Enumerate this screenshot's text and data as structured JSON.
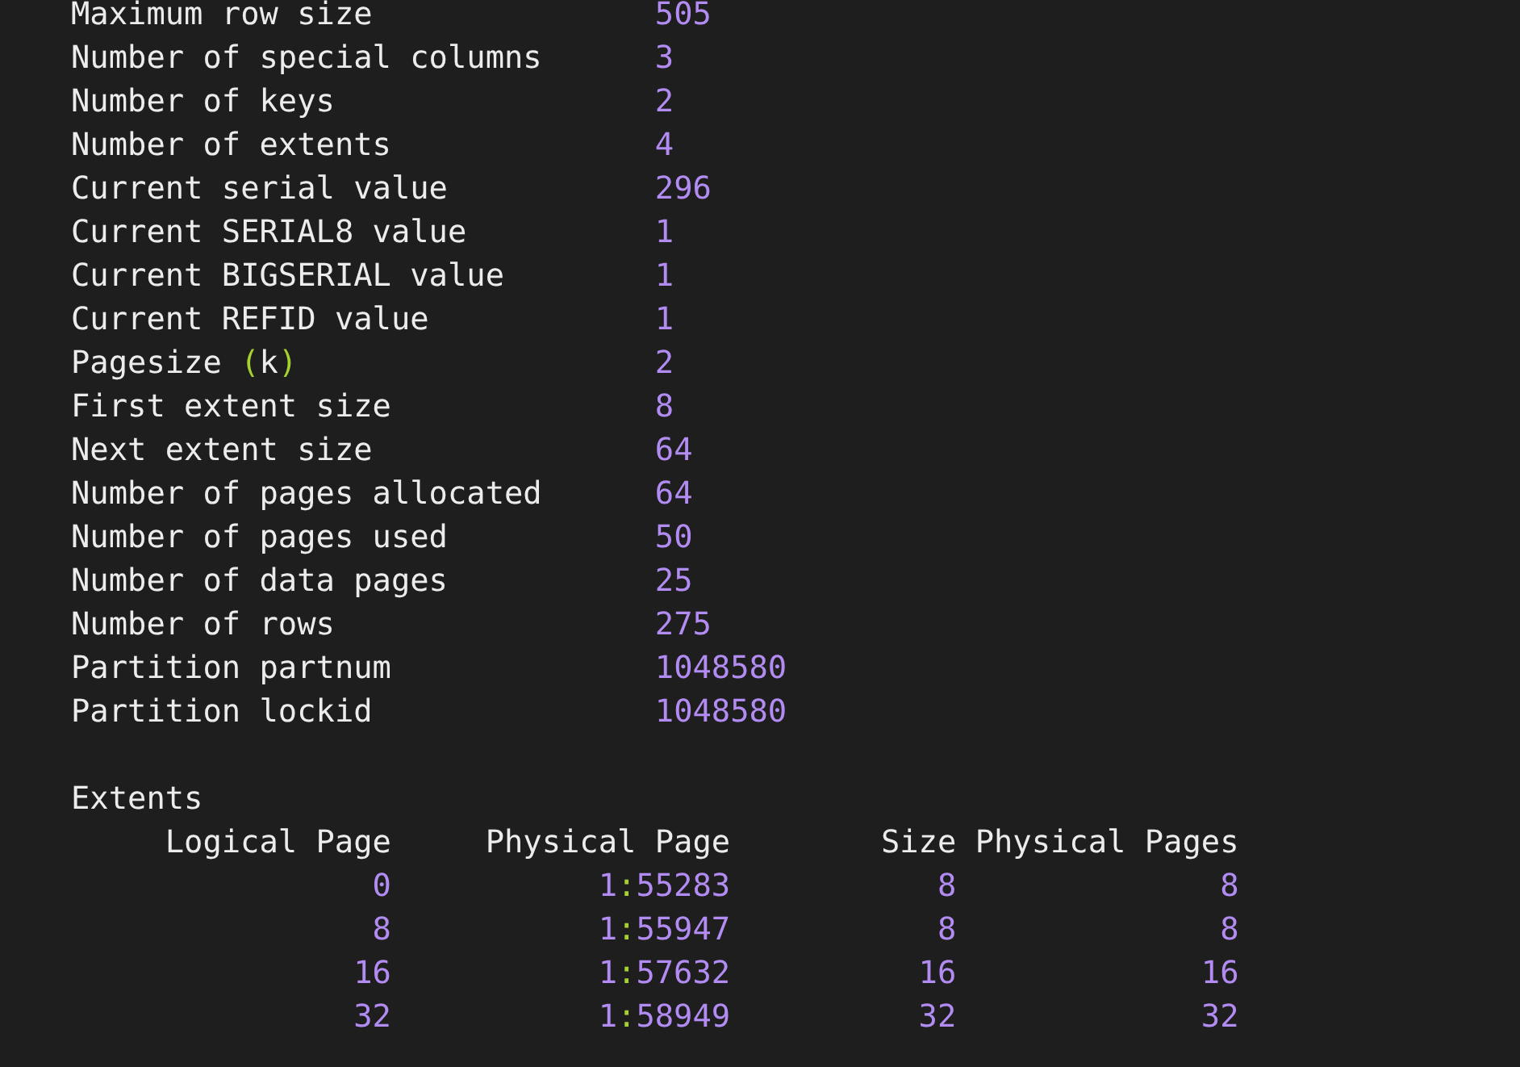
{
  "fields": [
    {
      "label": "Maximum row size",
      "value": "505"
    },
    {
      "label": "Number of special columns",
      "value": "3"
    },
    {
      "label": "Number of keys",
      "value": "2"
    },
    {
      "label": "Number of extents",
      "value": "4"
    },
    {
      "label": "Current serial value",
      "value": "296"
    },
    {
      "label": "Current SERIAL8 value",
      "value": "1"
    },
    {
      "label": "Current BIGSERIAL value",
      "value": "1"
    },
    {
      "label": "Current REFID value",
      "value": "1"
    },
    {
      "label": "Pagesize (k)",
      "value": "2"
    },
    {
      "label": "First extent size",
      "value": "8"
    },
    {
      "label": "Next extent size",
      "value": "64"
    },
    {
      "label": "Number of pages allocated",
      "value": "64"
    },
    {
      "label": "Number of pages used",
      "value": "50"
    },
    {
      "label": "Number of data pages",
      "value": "25"
    },
    {
      "label": "Number of rows",
      "value": "275"
    },
    {
      "label": "Partition partnum",
      "value": "1048580"
    },
    {
      "label": "Partition lockid",
      "value": "1048580"
    }
  ],
  "extents": {
    "title": "Extents",
    "columns": [
      "Logical Page",
      "Physical Page",
      "Size",
      "Physical Pages"
    ],
    "rows": [
      [
        "0",
        "1:55283",
        "8",
        "8"
      ],
      [
        "8",
        "1:55947",
        "8",
        "8"
      ],
      [
        "16",
        "1:57632",
        "16",
        "16"
      ],
      [
        "32",
        "1:58949",
        "32",
        "32"
      ]
    ]
  }
}
